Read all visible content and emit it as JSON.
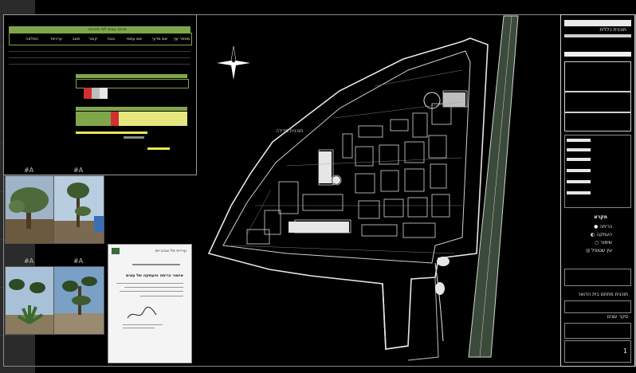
{
  "sidebar": {
    "slots": [
      "plan-icon",
      "plan-icon",
      "plan-icon",
      "plan-icon",
      "plan-icon",
      "plan-icon",
      "plan-icon",
      "plan-icon"
    ]
  },
  "table_sheet": {
    "header_title": "סיכום עצים לפי סטטוס",
    "columns": [
      "מספר עץ",
      "שם מדעי",
      "שם עממי",
      "גובה",
      "קוטר",
      "מצב",
      "ערכיות",
      "המלצה"
    ]
  },
  "photos": {
    "tags": [
      "#A",
      "#A",
      "#A",
      "#A"
    ]
  },
  "letter": {
    "org": "עיריית תל אביב-יפו",
    "subject": "אישור כריתה והעתקה של עצים"
  },
  "north_arrow": {
    "label": "N"
  },
  "site_plan": {
    "label": "תוכנית מדידה"
  },
  "title_block": {
    "project": "תוכנית כללית",
    "subtitle": "סקר עצים",
    "legend_title": "מקרא",
    "legend": [
      "כריתה",
      "העתקה",
      "שימור",
      "עץ שטופל"
    ],
    "footer_1": "תוכנית מתחם בית הדואר",
    "footer_2": "סקר עצים",
    "sheet_no": "1"
  },
  "colors": {
    "accent": "#7fa64a",
    "highlight": "#e8e84a",
    "red": "#d03030",
    "background": "#000000"
  }
}
